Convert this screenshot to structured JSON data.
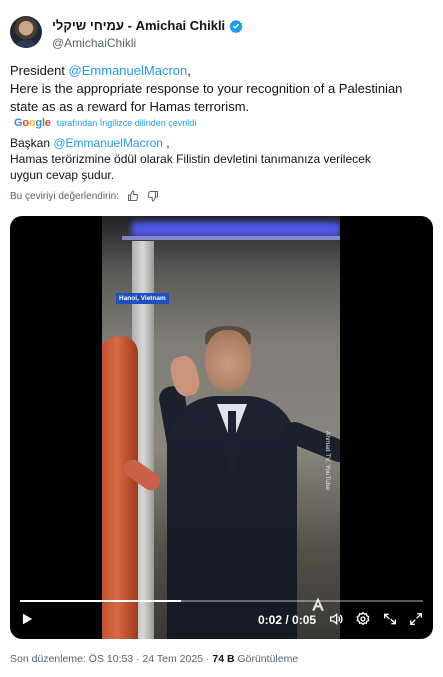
{
  "author": {
    "display_name": "עמיחי שיקלי - Amichai Chikli",
    "handle": "@AmichaiChikli"
  },
  "tweet": {
    "lines": [
      [
        "President ",
        "@EmmanuelMacron",
        ","
      ],
      "Here is the appropriate response to your recognition of a Palestinian",
      "state as as a reward for Hamas terrorism."
    ]
  },
  "translation": {
    "brand_letters": [
      "G",
      "o",
      "o",
      "g",
      "l",
      "e"
    ],
    "notice": "tarafından İngilizce dilinden çevrildi",
    "line1_prefix": "Başkan ",
    "line1_mention": "@EmmanuelMacron",
    "line1_suffix": " ,",
    "line2": "Hamas terörizmine ödül olarak Filistin devletini tanımanıza verilecek",
    "line3": "uygun cevap şudur.",
    "rate_prompt": "Bu çeviriyi değerlendirin:"
  },
  "video": {
    "location_badge": "Hanoi, Vietnam",
    "watermark": "Ahmad TV, YouTube",
    "time_display": "0:02 / 0:05",
    "progress_fraction": 0.4
  },
  "footer": {
    "edited_text": "Son düzenleme: ÖS 10:53 · 24 Tem 2025 · ",
    "views_count": "74 B",
    "views_label": " Görüntüleme"
  },
  "colors": {
    "accent": "#1d9bf0",
    "text_primary": "#0f1419",
    "text_secondary": "#536471"
  },
  "icons": [
    "verified-badge-icon",
    "thumbs-up-icon",
    "thumbs-down-icon",
    "play-icon",
    "volume-icon",
    "settings-icon",
    "pip-icon",
    "fullscreen-icon",
    "anadolu-logo-icon"
  ]
}
